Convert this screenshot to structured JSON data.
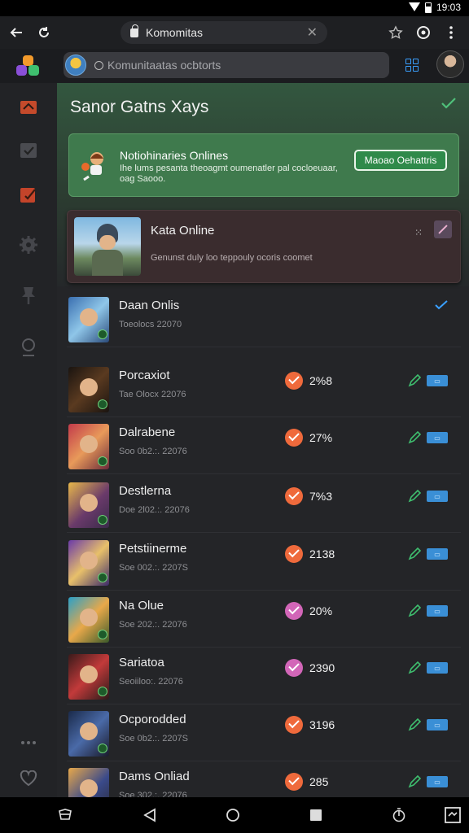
{
  "status_bar": {
    "time": "19:03"
  },
  "browser": {
    "url": "Komomitas"
  },
  "search": {
    "placeholder": "Komunitaatas ocbtorts"
  },
  "banner": {
    "title": "Sanor Gatns Xays",
    "notice": {
      "title": "Notiohinaries Onlines",
      "body": "Ihe lums pesanta theoagmt oumenatler pal cocloeuaar, oag Saooo.",
      "button": "Maoao Oehattris"
    }
  },
  "featured": {
    "title": "Kata Online",
    "description": "Genunst duly loo teppouly ocoris coomet"
  },
  "games": [
    {
      "title": "Daan Onlis",
      "sub": "Toeolocs 22070",
      "value": "",
      "status": "",
      "selected": true
    },
    {
      "title": "Porcaxiot",
      "sub": "Tae Olocx 22076",
      "value": "2%8",
      "status": "orange"
    },
    {
      "title": "Dalrabene",
      "sub": "Soo 0b2.:. 22076",
      "value": "27%",
      "status": "orange"
    },
    {
      "title": "Destlerna",
      "sub": "Doe 2l02.:. 22076",
      "value": "7%3",
      "status": "orange"
    },
    {
      "title": "Petstiinerme",
      "sub": "Soe 002.:. 2207S",
      "value": "2138",
      "status": "orange"
    },
    {
      "title": "Na Olue",
      "sub": "Soe 202.:. 22076",
      "value": "20%",
      "status": "pink"
    },
    {
      "title": "Sariatoa",
      "sub": "Seoiiloo:. 22076",
      "value": "2390",
      "status": "pink"
    },
    {
      "title": "Ocporodded",
      "sub": "Soe 0b2.:. 2207S",
      "value": "3196",
      "status": "orange"
    },
    {
      "title": "Dams Onliad",
      "sub": "Soe 302.:. 22076",
      "value": "285",
      "status": "orange"
    }
  ],
  "colors": {
    "accent": "#3aa0ff",
    "green": "#3f7a4d",
    "orange": "#ef6a3c",
    "pink": "#d266b8"
  }
}
